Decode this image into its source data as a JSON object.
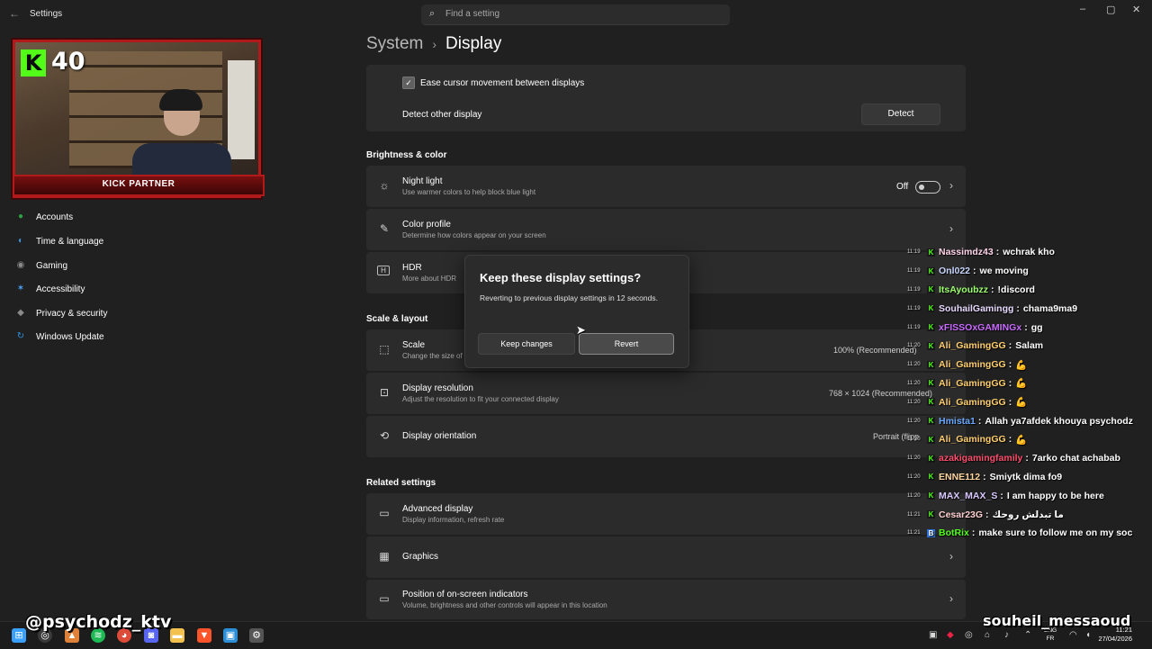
{
  "window": {
    "title": "Settings",
    "back_glyph": "←"
  },
  "search": {
    "placeholder": "Find a setting"
  },
  "window_controls": {
    "minimize": "–",
    "maximize": "▢",
    "close": "✕"
  },
  "sidebar": {
    "items": [
      {
        "label": "Accounts",
        "icon": "accounts-icon",
        "glyph": "●",
        "color": "#2ea043"
      },
      {
        "label": "Time & language",
        "icon": "globe-icon",
        "glyph": "◐",
        "color": "#3a96dd"
      },
      {
        "label": "Gaming",
        "icon": "gamepad-icon",
        "glyph": "◉",
        "color": "#8a8a8a"
      },
      {
        "label": "Accessibility",
        "icon": "accessibility-icon",
        "glyph": "✶",
        "color": "#4ba3ff"
      },
      {
        "label": "Privacy & security",
        "icon": "shield-icon",
        "glyph": "◆",
        "color": "#8a8a8a"
      },
      {
        "label": "Windows Update",
        "icon": "update-icon",
        "glyph": "↻",
        "color": "#2f8fdd"
      }
    ]
  },
  "breadcrumb": {
    "parent": "System",
    "separator": "›",
    "current": "Display"
  },
  "multiple_displays": {
    "ease_cursor_label": "Ease cursor movement between displays",
    "ease_cursor_checked": true,
    "detect_label": "Detect other display",
    "detect_button": "Detect"
  },
  "brightness_color": {
    "header": "Brightness & color",
    "night_light": {
      "title": "Night light",
      "subtitle": "Use warmer colors to help block blue light",
      "state": "Off"
    },
    "color_profile": {
      "title": "Color profile",
      "subtitle": "Determine how colors appear on your screen"
    },
    "hdr": {
      "title": "HDR",
      "subtitle": "More about HDR"
    }
  },
  "scale_layout": {
    "header": "Scale & layout",
    "scale": {
      "title": "Scale",
      "subtitle": "Change the size of",
      "value": "100% (Recommended)"
    },
    "resolution": {
      "title": "Display resolution",
      "subtitle": "Adjust the resolution to fit your connected display",
      "value": "768 × 1024 (Recommended)"
    },
    "orientation": {
      "title": "Display orientation",
      "value": "Portrait (flipp"
    }
  },
  "related": {
    "header": "Related settings",
    "advanced": {
      "title": "Advanced display",
      "subtitle": "Display information, refresh rate"
    },
    "graphics": {
      "title": "Graphics"
    },
    "osd": {
      "title": "Position of on-screen indicators",
      "subtitle": "Volume, brightness and other controls will appear in this location"
    }
  },
  "dialog": {
    "title": "Keep these display settings?",
    "message": "Reverting to previous display settings in 12 seconds.",
    "keep_button": "Keep changes",
    "revert_button": "Revert"
  },
  "overlay": {
    "kick_letter": "K",
    "follower_count": "40",
    "partner_label": "KICK PARTNER",
    "handle_left": "@psychodz_ktv",
    "handle_right": "souheil_messaoud",
    "kick_color": "#53fc18",
    "frame_color": "#b01a1a"
  },
  "chat": {
    "messages": [
      {
        "time": "11:19",
        "user": "Nassimdz43",
        "color": "#ffd3e8",
        "text": "wchrak kho"
      },
      {
        "time": "11:19",
        "user": "Onl022",
        "color": "#c9d7ff",
        "text": "we moving"
      },
      {
        "time": "11:19",
        "user": "ItsAyoubzz",
        "color": "#9cff6e",
        "text": "!discord"
      },
      {
        "time": "11:19",
        "user": "SouhailGamingg",
        "color": "#e8d9ff",
        "text": "chama9ma9"
      },
      {
        "time": "11:19",
        "user": "xFISSOxGAMINGx",
        "color": "#c86bff",
        "text": "gg"
      },
      {
        "time": "11:20",
        "user": "Ali_GamingGG",
        "color": "#ffcf6e",
        "text": "💪"
      },
      {
        "time": "11:20",
        "user": "Ali_GamingGG",
        "color": "#ffcf6e",
        "text": "💪"
      },
      {
        "time": "11:20",
        "user": "Ali_GamingGG",
        "color": "#ffcf6e",
        "text": "💪"
      },
      {
        "time": "11:20",
        "user": "Ali_GamingGG",
        "color": "#ffcf6e",
        "text": "💪"
      },
      {
        "time": "11:20",
        "user": "Hmista1",
        "color": "#6aa8ff",
        "text": "Allah ya7afdek khouya psychodz"
      },
      {
        "time": "11:20",
        "user": "Ali_GamingGG",
        "color": "#ffcf6e",
        "text": "💪"
      },
      {
        "time": "11:20",
        "user": "azakigamingfamily",
        "color": "#ff4d6d",
        "text": "7arko chat achabab"
      },
      {
        "time": "11:20",
        "user": "ENNE112",
        "color": "#ffd6a0",
        "text": "Smiytk dima fo9"
      },
      {
        "time": "11:20",
        "user": "MAX_MAX_S",
        "color": "#d9c8ff",
        "text": "I am happy to be here"
      },
      {
        "time": "11:21",
        "user": "Cesar23G",
        "color": "#ffd0d0",
        "text": "ما تبدلش روحك"
      },
      {
        "time": "11:21",
        "user": "BotRix",
        "color": "#53fc18",
        "text": "make sure to follow me on my soc"
      }
    ]
  },
  "taskbar": {
    "apps": [
      {
        "icon": "windows-start-icon",
        "glyph": "⊞",
        "color": "#3aa0ff"
      },
      {
        "icon": "obs-icon",
        "glyph": "◎",
        "color": "#3a3a3a"
      },
      {
        "icon": "fire-app-icon",
        "glyph": "▲",
        "color": "#e0813a"
      },
      {
        "icon": "spotify-icon",
        "glyph": "≋",
        "color": "#1db954"
      },
      {
        "icon": "chrome-icon",
        "glyph": "◕",
        "color": "#dd4b39"
      },
      {
        "icon": "discord-icon",
        "glyph": "◙",
        "color": "#5865f2"
      },
      {
        "icon": "folder-icon",
        "glyph": "▬",
        "color": "#f2c14e"
      },
      {
        "icon": "brave-icon",
        "glyph": "▼",
        "color": "#fb542b"
      },
      {
        "icon": "photos-icon",
        "glyph": "▣",
        "color": "#2c8fd6"
      },
      {
        "icon": "settings-icon",
        "glyph": "⚙",
        "color": "#555555"
      }
    ],
    "language": "ENG",
    "region": "FR",
    "time": "11:21",
    "date": "27/04/2026"
  }
}
